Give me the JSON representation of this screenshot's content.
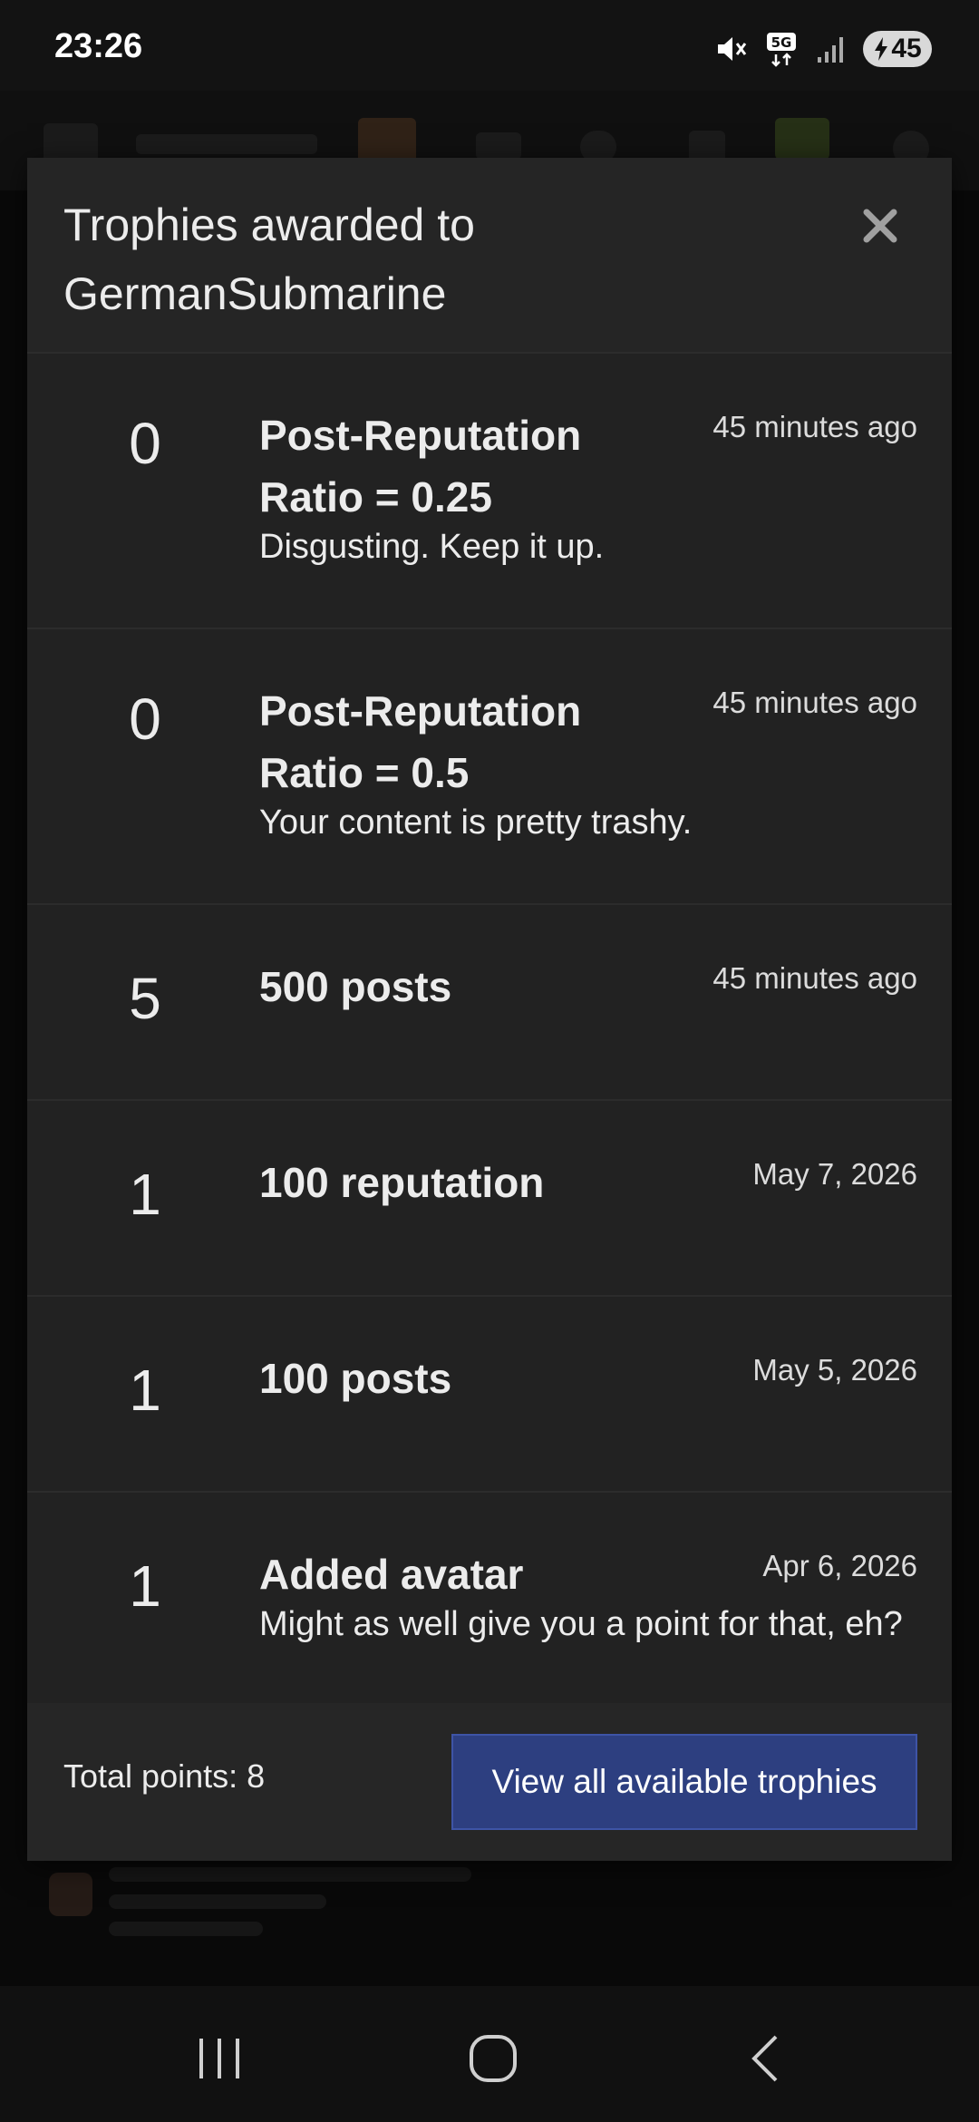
{
  "status_bar": {
    "time": "23:26",
    "battery_level": "45",
    "icons": [
      "mute-icon",
      "5g-icon",
      "signal-icon",
      "battery-charging-icon"
    ]
  },
  "modal": {
    "title": "Trophies awarded to GermanSubmarine",
    "trophies": [
      {
        "points": "0",
        "name": "Post-Reputation Ratio = 0.25",
        "description": "Disgusting. Keep it up.",
        "time": "45 minutes ago"
      },
      {
        "points": "0",
        "name": "Post-Reputation Ratio = 0.5",
        "description": "Your content is pretty trashy.",
        "time": "45 minutes ago"
      },
      {
        "points": "5",
        "name": "500 posts",
        "description": "",
        "time": "45 minutes ago"
      },
      {
        "points": "1",
        "name": "100 reputation",
        "description": "",
        "time": "May 7, 2026"
      },
      {
        "points": "1",
        "name": "100 posts",
        "description": "",
        "time": "May 5, 2026"
      },
      {
        "points": "1",
        "name": "Added avatar",
        "description": "Might as well give you a point for that, eh?",
        "time": "Apr 6, 2026"
      }
    ],
    "total_points": "Total points: 8",
    "view_all_label": "View all available trophies"
  },
  "colors": {
    "modal_bg": "#222222",
    "button_bg": "#2d3f80",
    "text": "#ececec"
  }
}
